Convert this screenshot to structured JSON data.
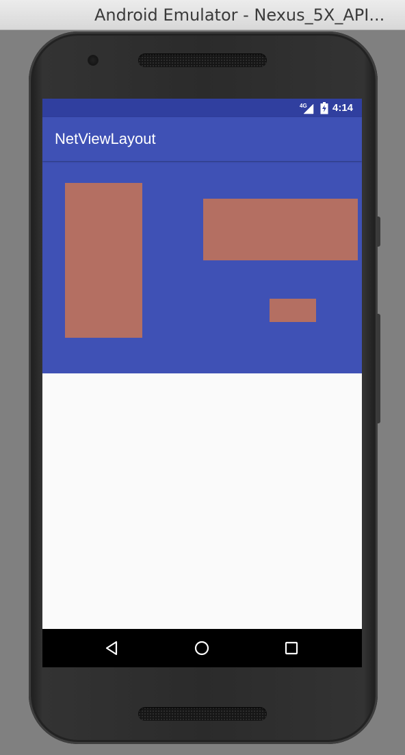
{
  "window": {
    "title": "Android Emulator - Nexus_5X_API..."
  },
  "status_bar": {
    "network_label": "4G",
    "time": "4:14",
    "signal_icon": "cellular-signal-icon",
    "battery_icon": "battery-charging-icon"
  },
  "app_bar": {
    "title": "NetViewLayout"
  },
  "colors": {
    "status_bar": "#303f9f",
    "primary": "#3f51b5",
    "block": "#b46f62",
    "content_background": "#fafafa",
    "nav_bar": "#000000"
  },
  "nav_bar": {
    "back_icon": "back-triangle-icon",
    "home_icon": "home-circle-icon",
    "recents_icon": "recents-square-icon"
  }
}
